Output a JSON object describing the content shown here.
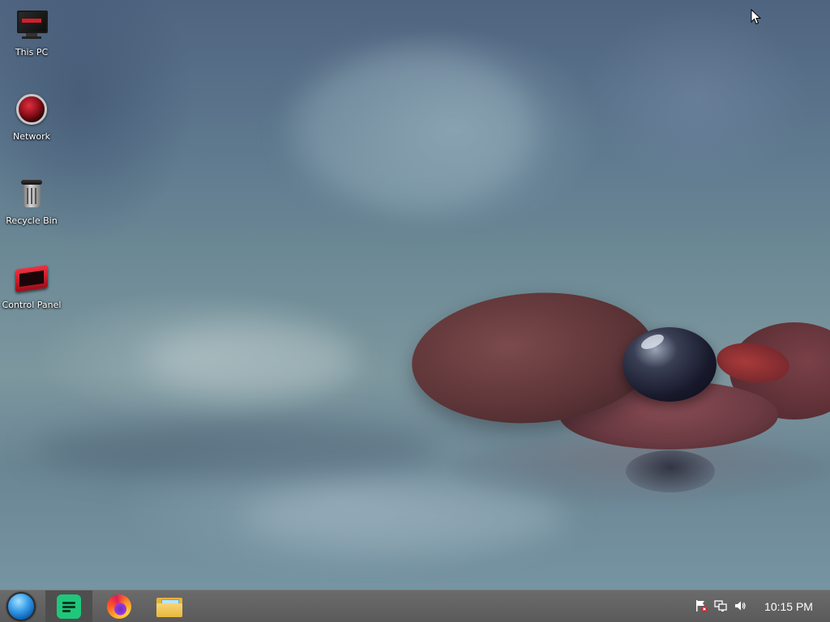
{
  "desktop": {
    "icons": [
      {
        "label": "This PC",
        "icon": "computer-icon"
      },
      {
        "label": "Network",
        "icon": "network-icon"
      },
      {
        "label": "Recycle Bin",
        "icon": "recycle-bin-icon"
      },
      {
        "label": "Control Panel",
        "icon": "control-panel-icon"
      }
    ]
  },
  "taskbar": {
    "start_icon": "start-orb-icon",
    "pinned": [
      {
        "icon": "notes-app-icon",
        "active": true
      },
      {
        "icon": "firefox-icon",
        "active": false
      },
      {
        "icon": "file-explorer-icon",
        "active": false
      }
    ],
    "tray": {
      "icons": [
        "action-center-flag-icon",
        "network-status-icon",
        "volume-icon"
      ],
      "clock": "10:15 PM"
    }
  },
  "colors": {
    "taskbar": "#5f5f5f",
    "accent_red": "#d01f2a",
    "notes_green": "#1fc77a"
  }
}
